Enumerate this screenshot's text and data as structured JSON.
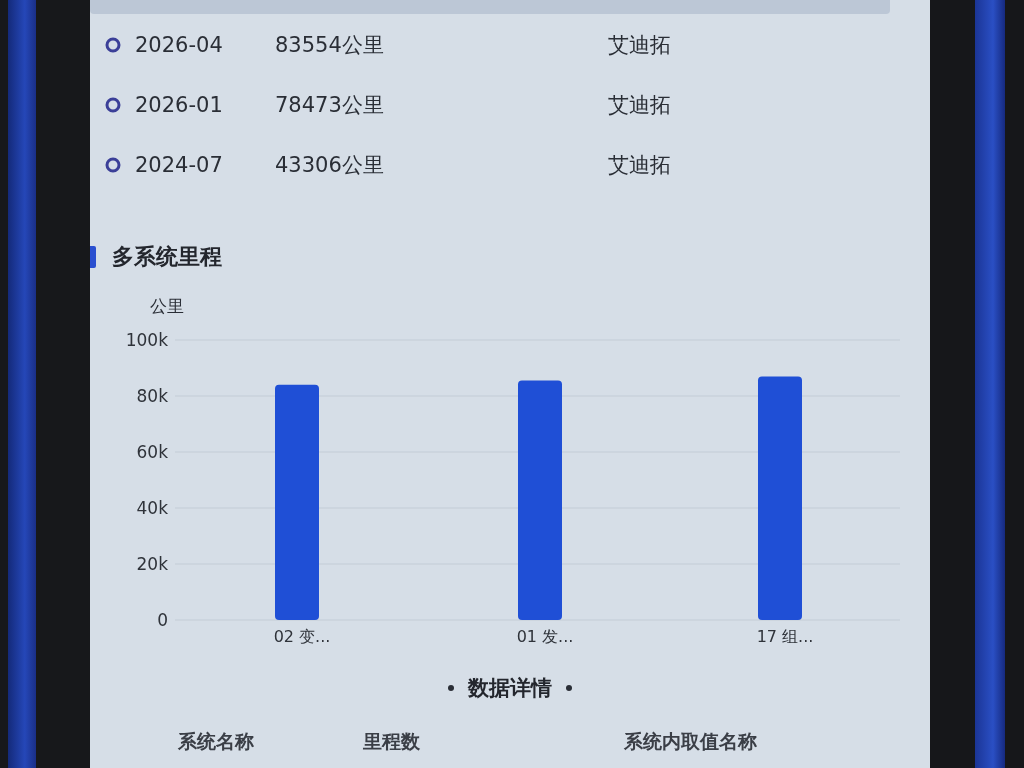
{
  "timeline": [
    {
      "date": "2026-04",
      "mileage": "83554公里",
      "brand": "艾迪拓"
    },
    {
      "date": "2026-01",
      "mileage": "78473公里",
      "brand": "艾迪拓"
    },
    {
      "date": "2024-07",
      "mileage": "43306公里",
      "brand": "艾迪拓"
    }
  ],
  "mileage_section": {
    "title": "多系统里程",
    "chart_data": {
      "type": "bar",
      "ylabel": "公里",
      "categories": [
        "02 变...",
        "01 发...",
        "17 组..."
      ],
      "values": [
        84000,
        85500,
        87000
      ],
      "ylim": [
        0,
        100000
      ],
      "yticks": [
        {
          "value": 0,
          "label": "0"
        },
        {
          "value": 20000,
          "label": "20k"
        },
        {
          "value": 40000,
          "label": "40k"
        },
        {
          "value": 60000,
          "label": "60k"
        },
        {
          "value": 80000,
          "label": "80k"
        },
        {
          "value": 100000,
          "label": "100k"
        }
      ],
      "grid": true
    }
  },
  "data_details": {
    "title": "数据详情",
    "columns": [
      "系统名称",
      "里程数",
      "系统内取值名称"
    ]
  }
}
